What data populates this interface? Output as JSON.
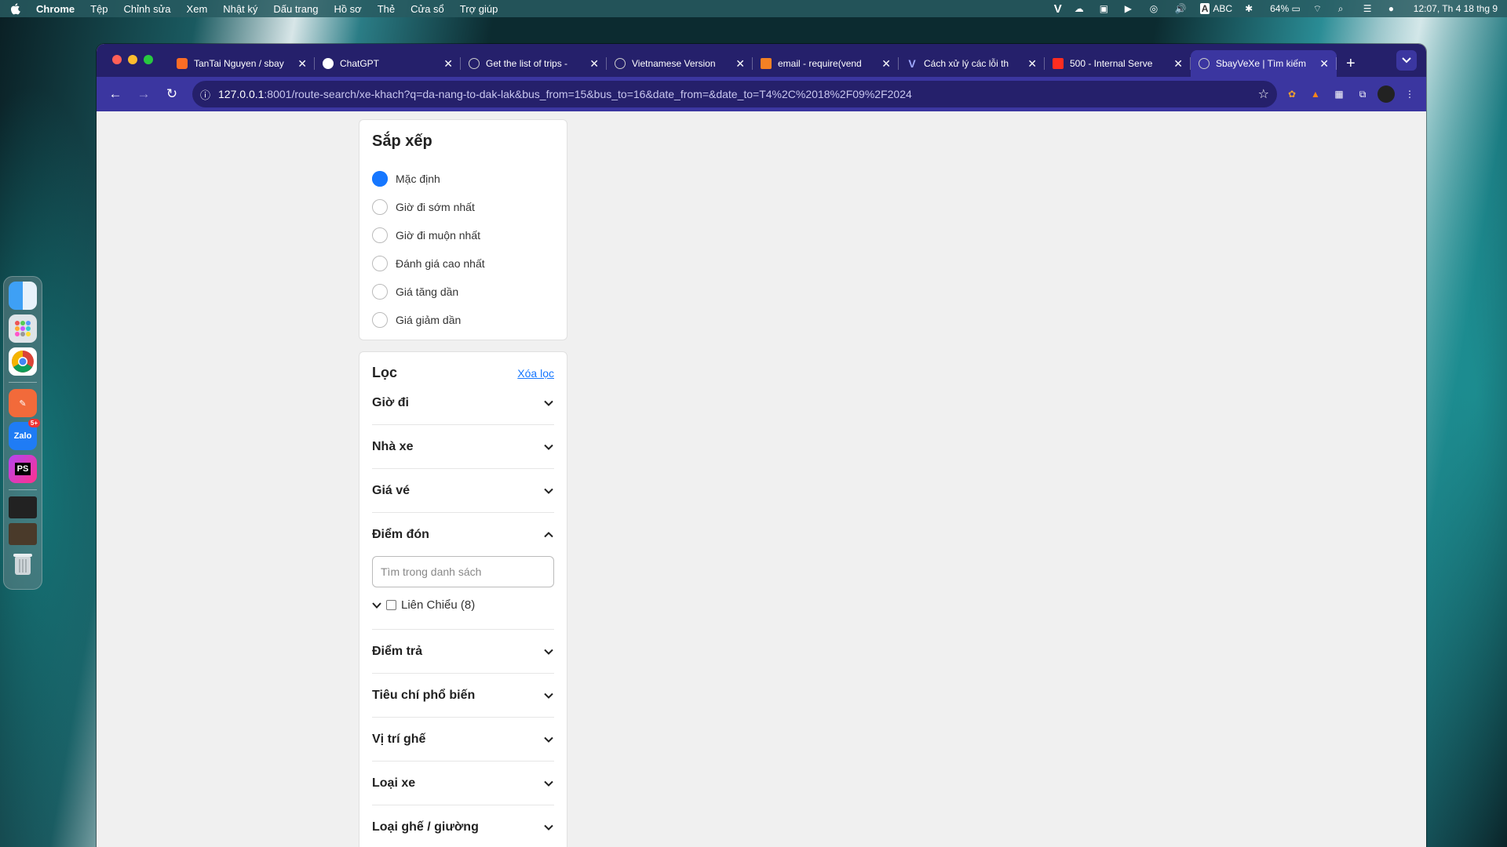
{
  "menubar": {
    "app": "Chrome",
    "items": [
      "Tệp",
      "Chỉnh sửa",
      "Xem",
      "Nhật ký",
      "Dấu trang",
      "Hồ sơ",
      "Thẻ",
      "Cửa sổ",
      "Trợ giúp"
    ],
    "input_source": "ABC",
    "battery": "64%",
    "clock": "12:07, Th 4 18 thg 9"
  },
  "dock": {
    "zalo_badge": "5+",
    "phpstorm_label": "PS",
    "zalo_label": "Zalo"
  },
  "browser": {
    "tabs": [
      {
        "title": "TanTai Nguyen / sbay",
        "icon": "gitlab-icon"
      },
      {
        "title": "ChatGPT",
        "icon": "chatgpt-icon"
      },
      {
        "title": "Get the list of trips -",
        "icon": "globe-icon"
      },
      {
        "title": "Vietnamese Version",
        "icon": "globe-icon"
      },
      {
        "title": "email - require(vend",
        "icon": "stackoverflow-icon"
      },
      {
        "title": "Cách xử lý các lỗi th",
        "icon": "vue-icon"
      },
      {
        "title": "500 - Internal Serve",
        "icon": "laravel-icon"
      },
      {
        "title": "SbayVeXe | Tìm kiếm",
        "icon": "globe-icon",
        "active": true
      }
    ],
    "url_host": "127.0.0.1",
    "url_rest": ":8001/route-search/xe-khach?q=da-nang-to-dak-lak&bus_from=15&bus_to=16&date_from=&date_to=T4%2C%2018%2F09%2F2024"
  },
  "sort": {
    "title": "Sắp xếp",
    "options": [
      {
        "label": "Mặc định",
        "checked": true
      },
      {
        "label": "Giờ đi sớm nhất",
        "checked": false
      },
      {
        "label": "Giờ đi muộn nhất",
        "checked": false
      },
      {
        "label": "Đánh giá cao nhất",
        "checked": false
      },
      {
        "label": "Giá tăng dần",
        "checked": false
      },
      {
        "label": "Giá giảm dần",
        "checked": false
      }
    ]
  },
  "filter": {
    "title": "Lọc",
    "clear_label": "Xóa lọc",
    "sections": {
      "departure_time": "Giờ đi",
      "bus_company": "Nhà xe",
      "price": "Giá vé",
      "pickup": "Điểm đón",
      "dropoff": "Điểm trả",
      "popular": "Tiêu chí phổ biến",
      "seat_position": "Vị trí ghế",
      "bus_type": "Loại xe",
      "seat_bed_type": "Loại ghế / giường"
    },
    "pickup_search_placeholder": "Tìm trong danh sách",
    "pickup_options": [
      {
        "label": "Liên Chiểu (8)",
        "checked": false
      }
    ]
  }
}
